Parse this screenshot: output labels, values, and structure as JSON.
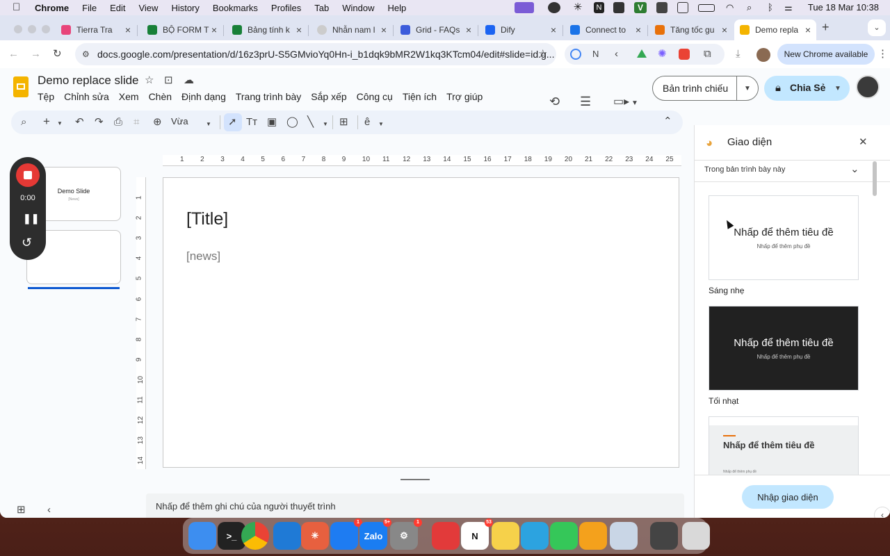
{
  "menubar": {
    "app": "Chrome",
    "items": [
      "File",
      "Edit",
      "View",
      "History",
      "Bookmarks",
      "Profiles",
      "Tab",
      "Window",
      "Help"
    ],
    "clock": "Tue 18 Mar  10:38"
  },
  "tabs": [
    {
      "title": "Tierra Tra",
      "color": "#e8457a"
    },
    {
      "title": "BỘ FORM T",
      "color": "#188038"
    },
    {
      "title": "Bảng tính k",
      "color": "#188038"
    },
    {
      "title": "Nhẫn nam l",
      "color": "#aaaaaa"
    },
    {
      "title": "Grid - FAQs",
      "color": "#3b5bdb"
    },
    {
      "title": "Dify",
      "color": "#1c64f2"
    },
    {
      "title": "Connect to",
      "color": "#1a73e8"
    },
    {
      "title": "Tăng tốc gu",
      "color": "#e8710a"
    },
    {
      "title": "Demo repla",
      "color": "#f4b400"
    }
  ],
  "address": {
    "url": "docs.google.com/presentation/d/16z3prU-S5GMvioYq0Hn-i_b1dqk9bMR2W1kq3KTcm04/edit#slide=id.g..."
  },
  "new_chrome": "New Chrome available",
  "doc": {
    "title": "Demo replace slide",
    "menus": [
      "Tệp",
      "Chỉnh sửa",
      "Xem",
      "Chèn",
      "Định dạng",
      "Trang trình bày",
      "Sắp xếp",
      "Công cụ",
      "Tiện ích",
      "Trợ giúp"
    ],
    "present": "Bản trình chiếu",
    "share": "Chia Sẻ",
    "zoom": "Vừa"
  },
  "recorder": {
    "time": "0:00"
  },
  "thumbs": {
    "t1_title": "Demo Slide",
    "t1_sub": "[News]"
  },
  "slide": {
    "title": "[Title]",
    "subtitle": "[news]"
  },
  "notes": "Nhấp để thêm ghi chú của người thuyết trình",
  "themes": {
    "title": "Giao diện",
    "dropdown": "Trong bản trình bày này",
    "cards": [
      {
        "main": "Nhấp để thêm tiêu đề",
        "sub": "Nhấp để thêm phụ đề",
        "name": "Sáng nhẹ"
      },
      {
        "main": "Nhấp để thêm tiêu đề",
        "sub": "Nhấp để thêm phụ đề",
        "name": "Tối nhạt"
      },
      {
        "main": "Nhấp để thêm tiêu đề",
        "sub": "Nhấp để thêm phụ đề",
        "name": ""
      }
    ],
    "import_button": "Nhập giao diện"
  },
  "ruler": {
    "h": [
      "1",
      "2",
      "3",
      "4",
      "5",
      "6",
      "7",
      "8",
      "9",
      "10",
      "11",
      "12",
      "13",
      "14",
      "15",
      "16",
      "17",
      "18",
      "19",
      "20",
      "21",
      "22",
      "23",
      "24",
      "25"
    ],
    "v": [
      "1",
      "2",
      "3",
      "4",
      "5",
      "6",
      "7",
      "8",
      "9",
      "10",
      "11",
      "12",
      "13",
      "14"
    ]
  },
  "dock": [
    {
      "name": "Finder",
      "color": "#3d8ef0",
      "label": ""
    },
    {
      "name": "Terminal",
      "color": "#222222",
      "label": ">_"
    },
    {
      "name": "Chrome",
      "color": "#e8e8e8",
      "label": ""
    },
    {
      "name": "VS Code",
      "color": "#1f7ad6",
      "label": ""
    },
    {
      "name": "Claude",
      "color": "#e7603f",
      "label": "✳"
    },
    {
      "name": "Messenger",
      "color": "#1e7cf2",
      "label": "",
      "badge": "1"
    },
    {
      "name": "Zalo",
      "color": "#1a7df2",
      "label": "Zalo",
      "badge": "5+"
    },
    {
      "name": "Settings",
      "color": "#888888",
      "label": "⚙",
      "badge": "1"
    },
    {
      "name": "App",
      "color": "#e23a3a",
      "label": ""
    },
    {
      "name": "Notion",
      "color": "#ffffff",
      "label": "N",
      "badge": "53"
    },
    {
      "name": "Notes",
      "color": "#f6d14a",
      "label": ""
    },
    {
      "name": "Telegram",
      "color": "#2ca3e0",
      "label": ""
    },
    {
      "name": "Messages",
      "color": "#35c759",
      "label": ""
    },
    {
      "name": "Pages",
      "color": "#f4a11c",
      "label": ""
    },
    {
      "name": "Preview",
      "color": "#c9d6e6",
      "label": ""
    },
    {
      "name": "Screenshot",
      "color": "#444444",
      "label": ""
    },
    {
      "name": "Trash",
      "color": "#d9d9d9",
      "label": ""
    }
  ]
}
